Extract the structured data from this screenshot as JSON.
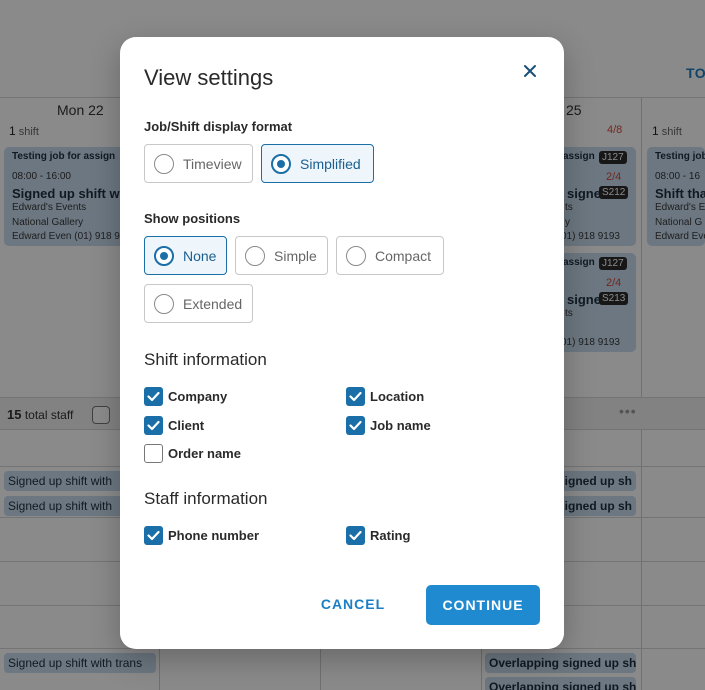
{
  "background": {
    "today_label": "TO",
    "day_mon": "Mon 22",
    "day_other": "25",
    "shift_count_1": "1",
    "shift_word": "shift",
    "ratio_top": "4/8",
    "cards": {
      "c1_title": "Testing job for assign",
      "c1_time": "08:00 - 16:00",
      "c1_name": "Signed up shift w",
      "c1_company": "Edward's Events",
      "c1_venue": "National Gallery",
      "c1_contact": "Edward Even (01) 918 9",
      "c2_title": "assign",
      "c2_job": "J127",
      "c2_ratio": "2/4",
      "c2_name": "signe",
      "c2_code": "S212",
      "c2_l1": "ts",
      "c2_l2": "y",
      "c2_phone": "01) 918 9193",
      "c3_title": "assign",
      "c3_job": "J127",
      "c3_ratio": "2/4",
      "c3_name": "signe",
      "c3_code": "S213",
      "c3_l1": "ts",
      "c3_phone": "01) 918 9193",
      "c4_title": "Testing job",
      "c4_time": "08:00 - 16",
      "c4_name": "Shift tha",
      "c4_company": "Edward's E",
      "c4_venue": "National G",
      "c4_contact": "Edward Eve"
    },
    "total_staff_count": "15",
    "total_staff_label": "total staff",
    "pills": {
      "p1": "Signed up shift with",
      "p2": "Signed up shift with",
      "p3": "signed up sh",
      "p4": "signed up sh",
      "p5": "Signed up shift with trans",
      "p6": "Overlapping signed up sh",
      "p7": "Overlapping signed up sh"
    }
  },
  "modal": {
    "title": "View settings",
    "display_format": {
      "label": "Job/Shift display format",
      "options": [
        "Timeview",
        "Simplified"
      ],
      "selected": "Simplified"
    },
    "positions": {
      "label": "Show positions",
      "options": [
        "None",
        "Simple",
        "Compact",
        "Extended"
      ],
      "selected": "None"
    },
    "shift_information": {
      "title": "Shift information",
      "items": [
        {
          "label": "Company",
          "checked": true
        },
        {
          "label": "Location",
          "checked": true
        },
        {
          "label": "Client",
          "checked": true
        },
        {
          "label": "Job name",
          "checked": true
        },
        {
          "label": "Order name",
          "checked": false
        }
      ]
    },
    "staff_information": {
      "title": "Staff information",
      "items": [
        {
          "label": "Phone number",
          "checked": true
        },
        {
          "label": "Rating",
          "checked": true
        }
      ]
    },
    "cancel_label": "CANCEL",
    "continue_label": "CONTINUE"
  },
  "colors": {
    "accent": "#1a6fa8",
    "button": "#1f8ad0",
    "card": "#c7dcef"
  },
  "icons": {
    "close": "close-icon",
    "check": "check-icon"
  }
}
